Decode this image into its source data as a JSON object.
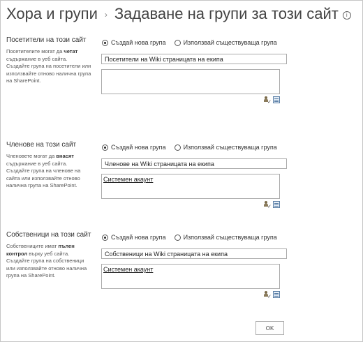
{
  "header": {
    "breadcrumb": "Хора и групи",
    "title": "Задаване на групи за този сайт",
    "info_icon_glyph": "i"
  },
  "sections": [
    {
      "title": "Посетители на този сайт",
      "desc_before": "Посетителите могат да ",
      "desc_bold": "четат",
      "desc_after": " съдържание в уеб сайта. Създайте група на посетители или използвайте отново налична група на SharePoint.",
      "radio_create": "Създай нова група",
      "radio_existing": "Използвай съществуваща група",
      "selected": "create",
      "group_name": "Посетители на Wiki страницата на екипа",
      "people": ""
    },
    {
      "title": "Членове на този сайт",
      "desc_before": "Членовете могат да ",
      "desc_bold": "внасят",
      "desc_after": " съдържание в уеб сайта. Създайте група на членове на сайта или използвайте отново налична група на SharePoint.",
      "radio_create": "Създай нова група",
      "radio_existing": "Използвай съществуваща група",
      "selected": "create",
      "group_name": "Членове на Wiki страницата на екипа",
      "people": "Системен акаунт"
    },
    {
      "title": "Собственици на този сайт",
      "desc_before": "Собствениците имат ",
      "desc_bold": "пълен контрол",
      "desc_after": " върху уеб сайта. Създайте група на собственици или използвайте отново налична група на SharePoint.",
      "radio_create": "Създай нова група",
      "radio_existing": "Използвай съществуваща група",
      "selected": "create",
      "group_name": "Собственици на Wiki страницата на екипа",
      "people": "Системен акаунт"
    }
  ],
  "footer": {
    "ok_label": "OK"
  },
  "icons": [
    "chevron-right-icon",
    "info-icon",
    "check-names-icon",
    "address-book-icon"
  ],
  "colors": {
    "text": "#444444",
    "border": "#ababab",
    "browse_icon": "#5b7fa6"
  }
}
